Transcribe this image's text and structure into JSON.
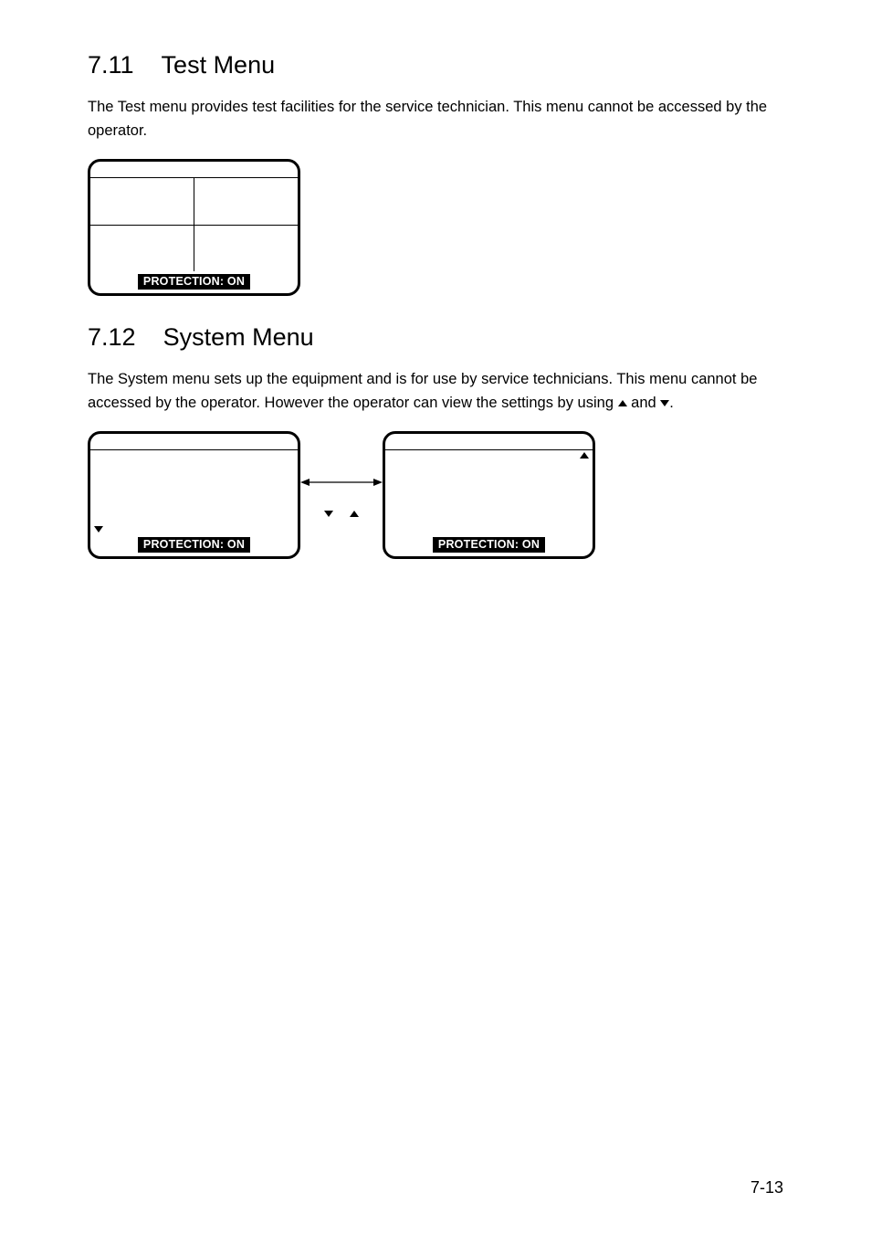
{
  "section1": {
    "number": "7.11",
    "title": "Test Menu",
    "body": "The Test menu provides test facilities for the service technician. This menu cannot be accessed by the operator.",
    "screen": {
      "footer": "PROTECTION: ON"
    }
  },
  "section2": {
    "number": "7.12",
    "title": "System Menu",
    "body_pre": "The System menu sets up the equipment and is for use by service technicians. This menu cannot be accessed by the operator. However the operator can view the settings by using ",
    "body_and": " and ",
    "body_post": ".",
    "screen1": {
      "footer": "PROTECTION: ON"
    },
    "screen2": {
      "footer": "PROTECTION: ON"
    }
  },
  "page_number": "7-13"
}
